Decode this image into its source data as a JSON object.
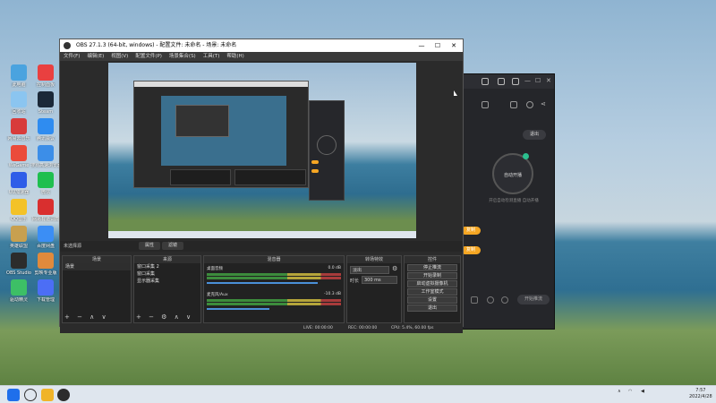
{
  "desktop": {
    "icons": [
      {
        "label": "此电脑",
        "color": "#4aa3df"
      },
      {
        "label": "控制面板",
        "color": "#e94040"
      },
      {
        "label": "回收站",
        "color": "#8bc5f0"
      },
      {
        "label": "Steam",
        "color": "#1b2838"
      },
      {
        "label": "网易云音乐",
        "color": "#d83b3b"
      },
      {
        "label": "腾讯会议",
        "color": "#2f8cf0"
      },
      {
        "label": "WeGame",
        "color": "#eb4b3b"
      },
      {
        "label": "搜狗高速浏览器",
        "color": "#3c8ee8"
      },
      {
        "label": "UU加速器",
        "color": "#2e5de8"
      },
      {
        "label": "微信",
        "color": "#1fbf4f"
      },
      {
        "label": "QQ音乐",
        "color": "#f3c228"
      },
      {
        "label": "网易有道词典",
        "color": "#d92f2f"
      },
      {
        "label": "英雄联盟",
        "color": "#c8a04f"
      },
      {
        "label": "百度网盘",
        "color": "#3b8ef5"
      },
      {
        "label": "OBS Studio",
        "color": "#2c2c2c"
      },
      {
        "label": "剪映专业版",
        "color": "#e08a3c"
      },
      {
        "label": "驱动精灵",
        "color": "#3dbf66"
      },
      {
        "label": "下载管理",
        "color": "#4c6ef5"
      }
    ]
  },
  "taskbar": {
    "time": "7:57",
    "date": "2022/4/28"
  },
  "backapp": {
    "exit_label": "退出",
    "circle_label": "自动开播",
    "sub_text": "开启自动检测直播 自动开播",
    "btn1": "复制",
    "btn2": "复制",
    "footer_btn": "开始推流"
  },
  "obs": {
    "title": "OBS 27.1.3 (64-bit, windows) - 配置文件: 未命名 - 场景: 未命名",
    "menu": [
      "文件(F)",
      "编辑(E)",
      "视图(V)",
      "配置文件(P)",
      "场景集合(S)",
      "工具(T)",
      "帮助(H)"
    ],
    "no_source": "未选择源",
    "props_btn": "属性",
    "filter_btn": "滤镜",
    "scenes": {
      "header": "场景",
      "items": [
        "场景"
      ]
    },
    "sources": {
      "header": "来源",
      "items": [
        "窗口采集 2",
        "窗口采集",
        "显示器采集"
      ]
    },
    "mixer": {
      "header": "混音器",
      "tracks": [
        {
          "name": "桌面音频",
          "db": "0.0 dB"
        },
        {
          "name": "麦克风/Aux",
          "db": "-10.3 dB"
        }
      ]
    },
    "transition": {
      "header": "转场特效",
      "type": "淡出",
      "duration_label": "时长",
      "duration": "300 ms"
    },
    "controls": {
      "header": "控件",
      "buttons": [
        "停止推流",
        "开始录制",
        "启动虚拟摄像机",
        "工作室模式",
        "设置",
        "退出"
      ]
    },
    "status": {
      "live": "LIVE: 00:00:00",
      "rec": "REC: 00:00:00",
      "cpu": "CPU: 5.4%, 60.00 fps"
    }
  }
}
